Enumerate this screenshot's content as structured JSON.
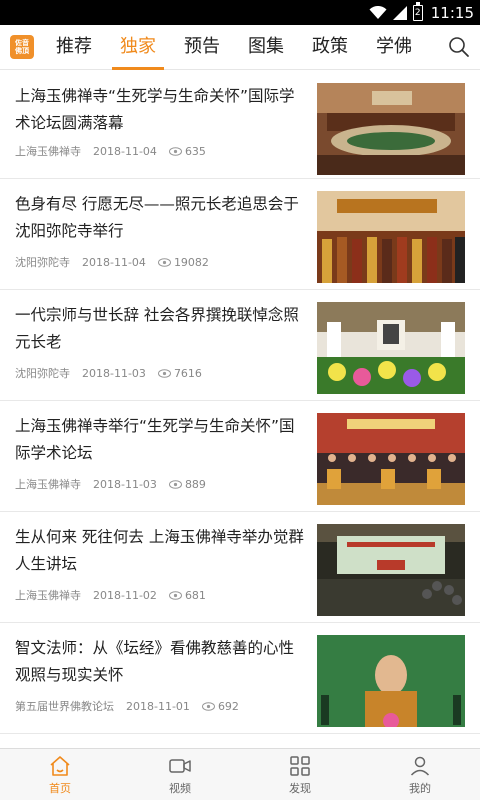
{
  "status": {
    "time": "11:15",
    "battery": "2"
  },
  "logo": {
    "line1": "佐音",
    "line2": "佛頂"
  },
  "tabs": [
    {
      "label": "推荐"
    },
    {
      "label": "独家"
    },
    {
      "label": "预告"
    },
    {
      "label": "图集"
    },
    {
      "label": "政策"
    },
    {
      "label": "学佛"
    }
  ],
  "active_tab": "独家",
  "feed": [
    {
      "title": "上海玉佛禅寺“生死学与生命关怀”国际学术论坛圆满落幕",
      "source": "上海玉佛禅寺",
      "date": "2018-11-04",
      "views": "635"
    },
    {
      "title": "色身有尽 行愿无尽——照元长老追思会于沈阳弥陀寺举行",
      "source": "沈阳弥陀寺",
      "date": "2018-11-04",
      "views": "19082"
    },
    {
      "title": "一代宗师与世长辞 社会各界撰挽联悼念照元长老",
      "source": "沈阳弥陀寺",
      "date": "2018-11-03",
      "views": "7616"
    },
    {
      "title": "上海玉佛禅寺举行“生死学与生命关怀”国际学术论坛",
      "source": "上海玉佛禅寺",
      "date": "2018-11-03",
      "views": "889"
    },
    {
      "title": "生从何来 死往何去 上海玉佛禅寺举办觉群人生讲坛",
      "source": "上海玉佛禅寺",
      "date": "2018-11-02",
      "views": "681"
    },
    {
      "title": "智文法师：从《坛经》看佛教慈善的心性观照与现实关怀",
      "source": "第五届世界佛教论坛",
      "date": "2018-11-01",
      "views": "692"
    }
  ],
  "bottom_nav": [
    {
      "label": "首页",
      "icon": "home-icon"
    },
    {
      "label": "视频",
      "icon": "video-icon"
    },
    {
      "label": "发现",
      "icon": "grid-icon"
    },
    {
      "label": "我的",
      "icon": "user-icon"
    }
  ],
  "colors": {
    "accent": "#f08a1c"
  }
}
